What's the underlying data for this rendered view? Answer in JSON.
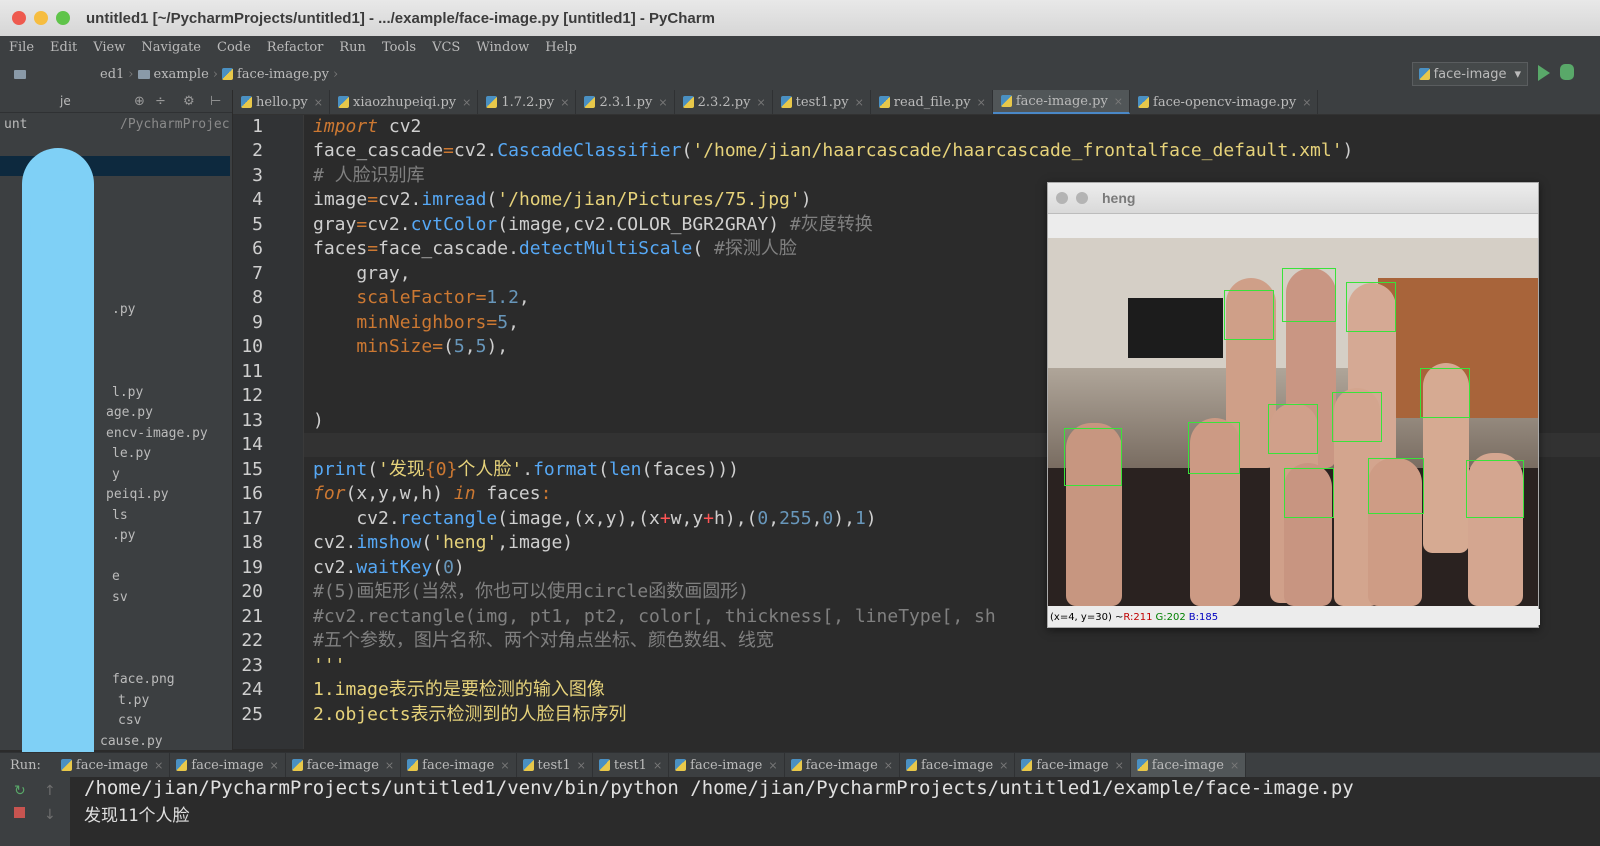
{
  "window": {
    "title": "untitled1 [~/PycharmProjects/untitled1] - .../example/face-image.py [untitled1] - PyCharm"
  },
  "menu": [
    "File",
    "Edit",
    "View",
    "Navigate",
    "Code",
    "Refactor",
    "Run",
    "Tools",
    "VCS",
    "Window",
    "Help"
  ],
  "breadcrumb": {
    "project": "ed1",
    "folder": "example",
    "file": "face-image.py"
  },
  "run_config": {
    "name": "face-image",
    "arrow": "▾",
    "run_icon": "play-icon",
    "debug_icon": "bug-icon"
  },
  "project_panel": {
    "header_label": "je",
    "root_label": "unt",
    "root_path": "/PycharmProjec",
    "items": [
      ".py",
      "l.py",
      "age.py",
      "encv-image.py",
      "le.py",
      "y",
      "peiqi.py",
      "ls",
      ".py",
      "e",
      "sv",
      "face.png",
      "t.py",
      "csv",
      "cause.py"
    ]
  },
  "tabs": [
    {
      "label": "hello.py",
      "active": false
    },
    {
      "label": "xiaozhupeiqi.py",
      "active": false
    },
    {
      "label": "1.7.2.py",
      "active": false
    },
    {
      "label": "2.3.1.py",
      "active": false
    },
    {
      "label": "2.3.2.py",
      "active": false
    },
    {
      "label": "test1.py",
      "active": false
    },
    {
      "label": "read_file.py",
      "active": false
    },
    {
      "label": "face-image.py",
      "active": true
    },
    {
      "label": "face-opencv-image.py",
      "active": false
    }
  ],
  "tab_close": "×",
  "code": {
    "line_numbers": [
      "1",
      "2",
      "3",
      "4",
      "5",
      "6",
      "7",
      "8",
      "9",
      "10",
      "11",
      "12",
      "13",
      "14",
      "15",
      "16",
      "17",
      "18",
      "19",
      "20",
      "21",
      "22",
      "23",
      "24",
      "25"
    ],
    "l1_kw": "import",
    "l1_rest": " cv2",
    "l2_a": "face_cascade",
    "l2_eq": "=",
    "l2_b": "cv2.",
    "l2_fn": "CascadeClassifier",
    "l2_p": "(",
    "l2_str": "'/home/jian/haarcascade/haarcascade_frontalface_default.xml'",
    "l2_e": ")",
    "l3": "# 人脸识别库",
    "l4_a": "image",
    "l4_eq": "=",
    "l4_b": "cv2.",
    "l4_fn": "imread",
    "l4_p": "(",
    "l4_str": "'/home/jian/Pictures/75.jpg'",
    "l4_e": ")",
    "l5_a": "gray",
    "l5_eq": "=",
    "l5_b": "cv2.",
    "l5_fn": "cvtColor",
    "l5_rest": "(image,cv2.COLOR_BGR2GRAY) ",
    "l5_cmt": "#灰度转换",
    "l6_a": "faces",
    "l6_eq": "=",
    "l6_b": "face_cascade.",
    "l6_fn": "detectMultiScale",
    "l6_p": "( ",
    "l6_cmt": "#探测人脸",
    "l7": "    gray,",
    "l8_p": "    scaleFactor",
    "l8_eq": "=",
    "l8_n": "1.2",
    "l8_e": ",",
    "l9_p": "    minNeighbors",
    "l9_eq": "=",
    "l9_n": "5",
    "l9_e": ",",
    "l10_p": "    minSize",
    "l10_eq": "=",
    "l10_a": "(",
    "l10_n1": "5",
    "l10_c": ",",
    "l10_n2": "5",
    "l10_e": "),",
    "l13": ")",
    "l15_fn": "print",
    "l15_p": "(",
    "l15_str1": "'发现",
    "l15_br": "{0}",
    "l15_str2": "个人脸'",
    "l15_d": ".",
    "l15_fn2": "format",
    "l15_p2": "(",
    "l15_fn3": "len",
    "l15_e": "(faces)))",
    "l16_kw": "for",
    "l16_a": "(x,y,w,h) ",
    "l16_kw2": "in",
    "l16_b": " faces",
    "l16_c": ":",
    "l17_a": "    cv2.",
    "l17_fn": "rectangle",
    "l17_b": "(image,(x,y),(x",
    "l17_op1": "+",
    "l17_c": "w,y",
    "l17_op2": "+",
    "l17_d": "h),(",
    "l17_n1": "0",
    "l17_e": ",",
    "l17_n2": "255",
    "l17_f": ",",
    "l17_n3": "0",
    "l17_g": "),",
    "l17_n4": "1",
    "l17_h": ")",
    "l18_a": "cv2.",
    "l18_fn": "imshow",
    "l18_p": "(",
    "l18_str": "'heng'",
    "l18_e": ",image)",
    "l19_a": "cv2.",
    "l19_fn": "waitKey",
    "l19_p": "(",
    "l19_n": "0",
    "l19_e": ")",
    "l20": "#(5)画矩形(当然，你也可以使用circle函数画圆形)",
    "l21": "#cv2.rectangle(img, pt1, pt2, color[, thickness[, lineType[, sh",
    "l22": "#五个参数，图片名称、两个对角点坐标、颜色数组、线宽",
    "l23": "'''",
    "l24": "1.image表示的是要检测的输入图像",
    "l25": "2.objects表示检测到的人脸目标序列"
  },
  "image_window": {
    "title": "heng",
    "status_pos": "(x=4, y=30) ~ ",
    "status_r": "R:211",
    "status_g": "G:202",
    "status_b": "B:185",
    "face_boxes": 11
  },
  "run_panel": {
    "label": "Run:",
    "tabs": [
      {
        "label": "face-image",
        "active": false
      },
      {
        "label": "face-image",
        "active": false
      },
      {
        "label": "face-image",
        "active": false
      },
      {
        "label": "face-image",
        "active": false
      },
      {
        "label": "test1",
        "active": false
      },
      {
        "label": "test1",
        "active": false
      },
      {
        "label": "face-image",
        "active": false
      },
      {
        "label": "face-image",
        "active": false
      },
      {
        "label": "face-image",
        "active": false
      },
      {
        "label": "face-image",
        "active": false
      },
      {
        "label": "face-image",
        "active": true
      }
    ],
    "output": [
      "/home/jian/PycharmProjects/untitled1/venv/bin/python /home/jian/PycharmProjects/untitled1/example/face-image.py",
      "发现11个人脸"
    ]
  },
  "colors": {
    "editor_bg": "#2b2b2b",
    "panel_bg": "#3c3f41",
    "face_box": "#39e33a",
    "scribble": "#7fd0f6"
  }
}
